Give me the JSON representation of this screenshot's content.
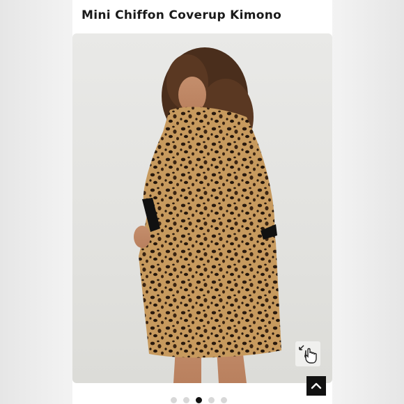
{
  "product": {
    "title": "Mini Chiffon Coverup Kimono"
  },
  "gallery": {
    "image_alt": "Model wearing leopard print chiffon kimono with black trim",
    "slide_count": 5,
    "active_slide": 3
  },
  "icons": {
    "zoom": "hand-pointer-zoom-icon",
    "scroll_top": "chevron-up-icon"
  },
  "colors": {
    "accent": "#111111",
    "dot_inactive": "#d8d8d8"
  }
}
